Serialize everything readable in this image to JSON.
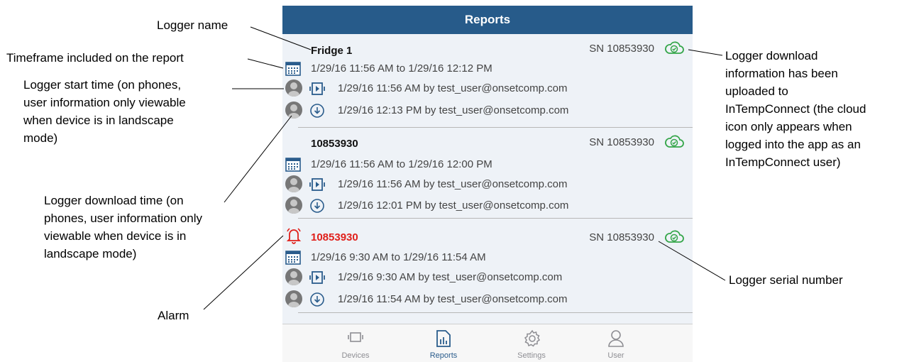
{
  "app": {
    "header_title": "Reports"
  },
  "reports": [
    {
      "title": "Fridge 1",
      "serial": "SN 10853930",
      "timeframe": "1/29/16 11:56 AM to 1/29/16 12:12 PM",
      "start": "1/29/16 11:56 AM by test_user@onsetcomp.com",
      "download": "1/29/16 12:13 PM by test_user@onsetcomp.com",
      "alarm": false
    },
    {
      "title": "10853930",
      "serial": "SN 10853930",
      "timeframe": "1/29/16 11:56 AM to 1/29/16 12:00 PM",
      "start": "1/29/16 11:56 AM by test_user@onsetcomp.com",
      "download": "1/29/16 12:01 PM by test_user@onsetcomp.com",
      "alarm": false
    },
    {
      "title": "10853930",
      "serial": "SN 10853930",
      "timeframe": "1/29/16 9:30 AM to 1/29/16 11:54 AM",
      "start": "1/29/16 9:30 AM by test_user@onsetcomp.com",
      "download": "1/29/16 11:54 AM by test_user@onsetcomp.com",
      "alarm": true
    }
  ],
  "tabs": [
    {
      "label": "Devices",
      "icon": "device-icon",
      "active": false
    },
    {
      "label": "Reports",
      "icon": "report-icon",
      "active": true
    },
    {
      "label": "Settings",
      "icon": "gear-icon",
      "active": false
    },
    {
      "label": "User",
      "icon": "user-icon",
      "active": false
    }
  ],
  "annotations": {
    "logger_name": "Logger name",
    "timeframe": "Timeframe included on the report",
    "start_time": [
      "Logger start time (on phones,",
      "user information only viewable",
      "when device is in landscape",
      "mode)"
    ],
    "download_time": [
      "Logger download time (on",
      "phones, user information only",
      "viewable when device is in",
      "landscape mode)"
    ],
    "alarm": "Alarm",
    "cloud": [
      "Logger download",
      "information has been",
      "uploaded to",
      "InTempConnect (the cloud",
      "icon only appears when",
      "logged into the app as an",
      "InTempConnect user)"
    ],
    "serial": "Logger serial number"
  },
  "colors": {
    "header": "#275b8a",
    "accent": "#2a5c8c",
    "cloud_green": "#35a64a",
    "alarm_red": "#e0201b"
  }
}
